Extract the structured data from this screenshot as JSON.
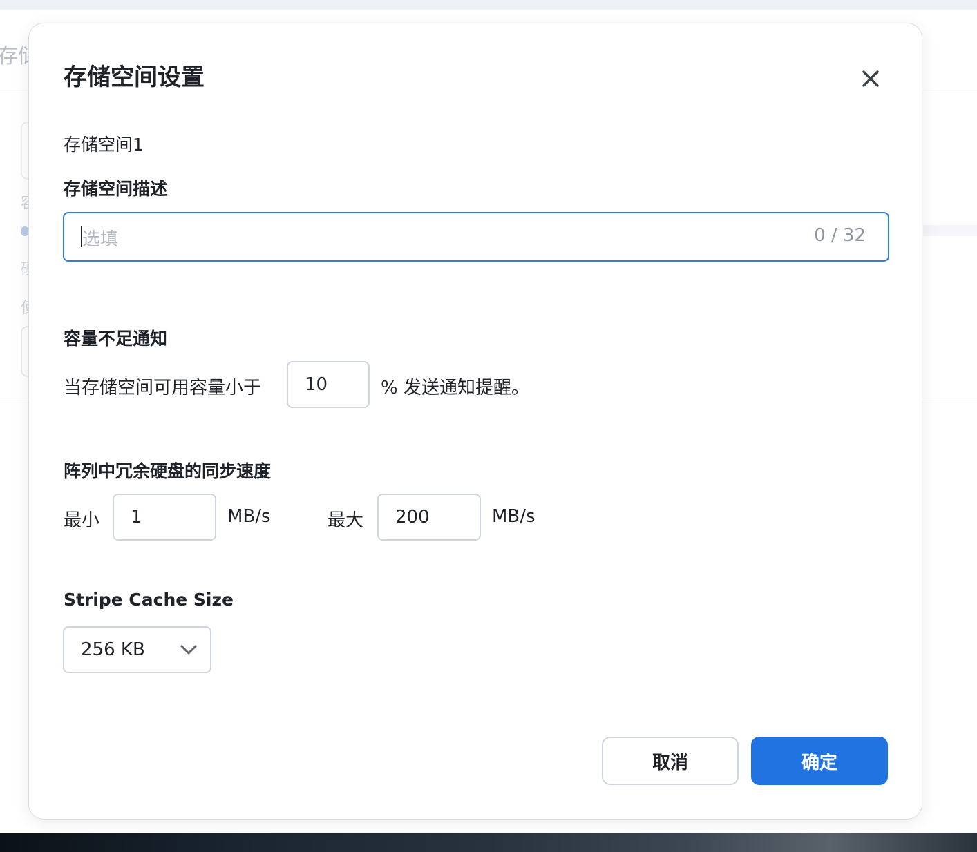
{
  "background": {
    "title_fragment": "存储",
    "side_chars": [
      "容",
      "硬",
      "使"
    ]
  },
  "dialog": {
    "title": "存储空间设置",
    "volume_name": "存储空间1",
    "description": {
      "label": "存储空间描述",
      "placeholder": "选填",
      "value": "",
      "counter": "0 / 32"
    },
    "low_capacity": {
      "label": "容量不足通知",
      "prefix": "当存储空间可用容量小于",
      "value": "10",
      "suffix": "% 发送通知提醒。"
    },
    "sync_speed": {
      "label": "阵列中冗余硬盘的同步速度",
      "min_label": "最小",
      "min_value": "1",
      "min_unit": "MB/s",
      "max_label": "最大",
      "max_value": "200",
      "max_unit": "MB/s"
    },
    "stripe_cache": {
      "label": "Stripe Cache Size",
      "selected": "256 KB"
    },
    "buttons": {
      "cancel": "取消",
      "confirm": "确定"
    },
    "icons": {
      "close": "close-icon",
      "dropdown": "chevron-down-icon"
    }
  },
  "colors": {
    "primary": "#2073e0",
    "focus_border": "#2d7ee0",
    "text": "#1f2329",
    "placeholder": "#b2b8c0"
  }
}
